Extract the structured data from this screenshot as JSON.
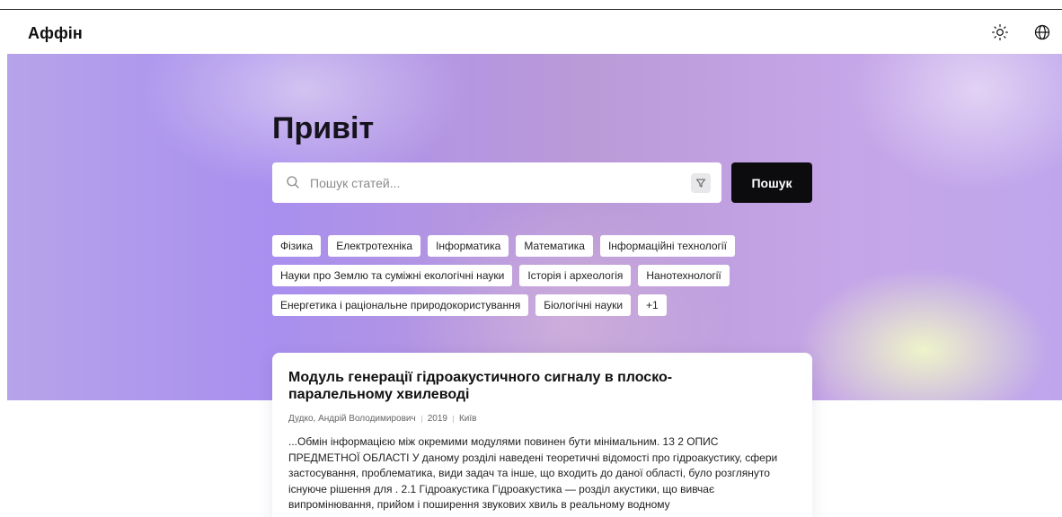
{
  "header": {
    "logo": "Аффін",
    "icons": [
      "sun-icon",
      "globe-icon"
    ]
  },
  "hero": {
    "title": "Привіт",
    "search": {
      "placeholder": "Пошук статей...",
      "button_label": "Пошук"
    },
    "tags": [
      [
        "Фізика",
        "Електротехніка",
        "Інформатика",
        "Математика",
        "Інформаційні технології"
      ],
      [
        "Науки про Землю та суміжні екологічні науки",
        "Історія і археологія",
        "Нанотехнології"
      ],
      [
        "Енергетика і раціональне природокористування",
        "Біологічні науки",
        "+1"
      ]
    ]
  },
  "result": {
    "title": "Модуль генерації гідроакустичного сигналу в плоско-паралельному хвилеводі",
    "author": "Дудко, Андрій Володимирович",
    "year": "2019",
    "city": "Київ",
    "snippet": "...Обмін інформацією між окремими модулями повинен бути мінімальним. 13 2 ОПИС ПРЕДМЕТНОЇ ОБЛАСТІ У даному розділі наведені теоретичні відомості про гідроакустику, сфери застосування, проблематика, види задач та інше, що входить до даної області, було розглянуто існуюче рішення для . 2.1 Гідроакустика Гідроакустика — розділ акустики, що вивчає випромінювання, прийом і поширення звукових хвиль в реальному водному"
  },
  "colors": {
    "hero_violet": "#a98fef",
    "hero_glow": "#f0f8c8",
    "button_bg": "#0c0c0e"
  }
}
